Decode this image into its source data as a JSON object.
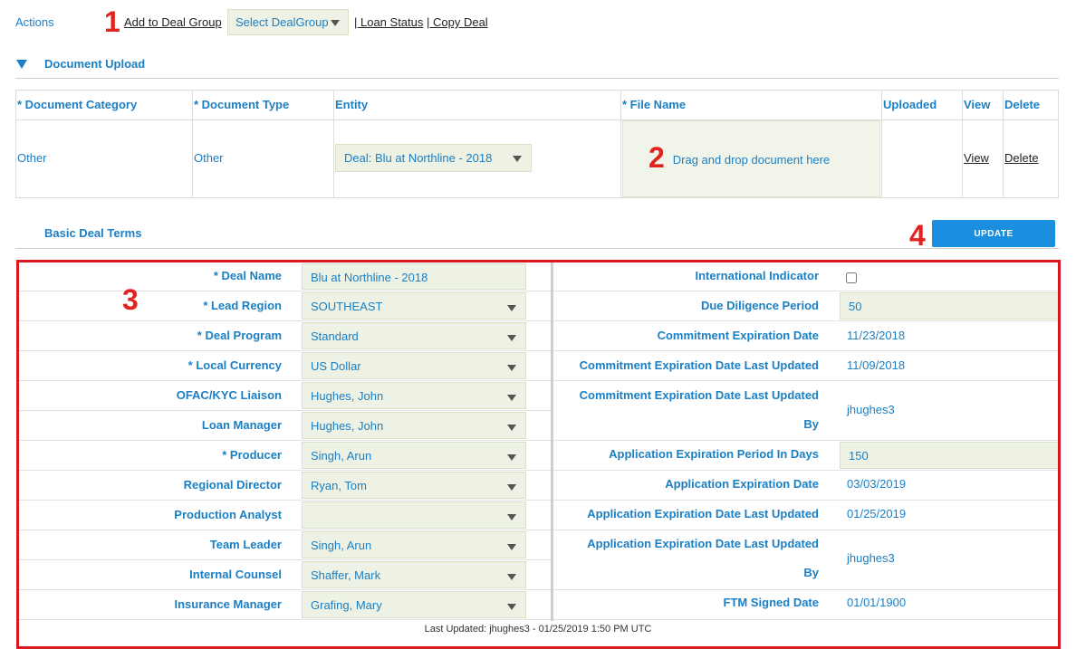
{
  "actions": {
    "label": "Actions",
    "add_to_deal_group": "Add to Deal Group",
    "select_deal_group": "Select DealGroup",
    "loan_status": "| Loan Status",
    "copy_deal": "| Copy Deal"
  },
  "document_upload": {
    "title": "Document Upload",
    "headers": [
      "* Document Category",
      "* Document Type",
      "Entity",
      "* File Name",
      "Uploaded",
      "View",
      "Delete"
    ],
    "row": {
      "category": "Other",
      "type": "Other",
      "entity": "Deal: Blu at Northline - 2018",
      "dropzone": "Drag and drop document here",
      "uploaded": "",
      "view": "View",
      "delete": "Delete"
    }
  },
  "basic_terms": {
    "title": "Basic Deal Terms",
    "update_label": "UPDATE",
    "left_fields": [
      {
        "label": "* Deal Name",
        "value": "Blu at Northline - 2018"
      },
      {
        "label": "* Lead Region",
        "value": "SOUTHEAST"
      },
      {
        "label": "* Deal Program",
        "value": "Standard"
      },
      {
        "label": "* Local Currency",
        "value": "US Dollar"
      },
      {
        "label": "OFAC/KYC Liaison",
        "value": "Hughes, John"
      },
      {
        "label": "Loan Manager",
        "value": "Hughes, John"
      },
      {
        "label": "* Producer",
        "value": "Singh, Arun"
      },
      {
        "label": "Regional Director",
        "value": "Ryan, Tom"
      },
      {
        "label": "Production Analyst",
        "value": ""
      },
      {
        "label": "Team Leader",
        "value": "Singh, Arun"
      },
      {
        "label": "Internal Counsel",
        "value": "Shaffer, Mark"
      },
      {
        "label": "Insurance Manager",
        "value": "Grafing, Mary"
      }
    ],
    "right_fields": {
      "international_indicator": "International Indicator",
      "due_diligence_label": "Due Diligence Period",
      "due_diligence_value": "50",
      "commit_exp_label": "Commitment Expiration Date",
      "commit_exp_value": "11/23/2018",
      "commit_exp_lu_label": "Commitment Expiration Date Last Updated",
      "commit_exp_lu_value": "11/09/2018",
      "commit_exp_lub_label_1": "Commitment Expiration Date Last Updated",
      "commit_exp_lub_label_2": "By",
      "commit_exp_lub_value": "jhughes3",
      "app_exp_period_label": "Application Expiration Period In Days",
      "app_exp_period_value": "150",
      "app_exp_label": "Application Expiration Date",
      "app_exp_value": "03/03/2019",
      "app_exp_lu_label": "Application Expiration Date Last Updated",
      "app_exp_lu_value": "01/25/2019",
      "app_exp_lub_label_1": "Application Expiration Date Last Updated",
      "app_exp_lub_label_2": "By",
      "app_exp_lub_value": "jhughes3",
      "ftm_label": "FTM Signed Date",
      "ftm_value": "01/01/1900"
    },
    "last_updated": "Last Updated: jhughes3 - 01/25/2019 1:50 PM UTC"
  },
  "callouts": [
    "1",
    "2",
    "3",
    "4"
  ],
  "colors": {
    "accent": "#1a7fc4",
    "button": "#1a8fe0",
    "highlight": "#d9181e",
    "field_bg": "#eef2e4"
  }
}
